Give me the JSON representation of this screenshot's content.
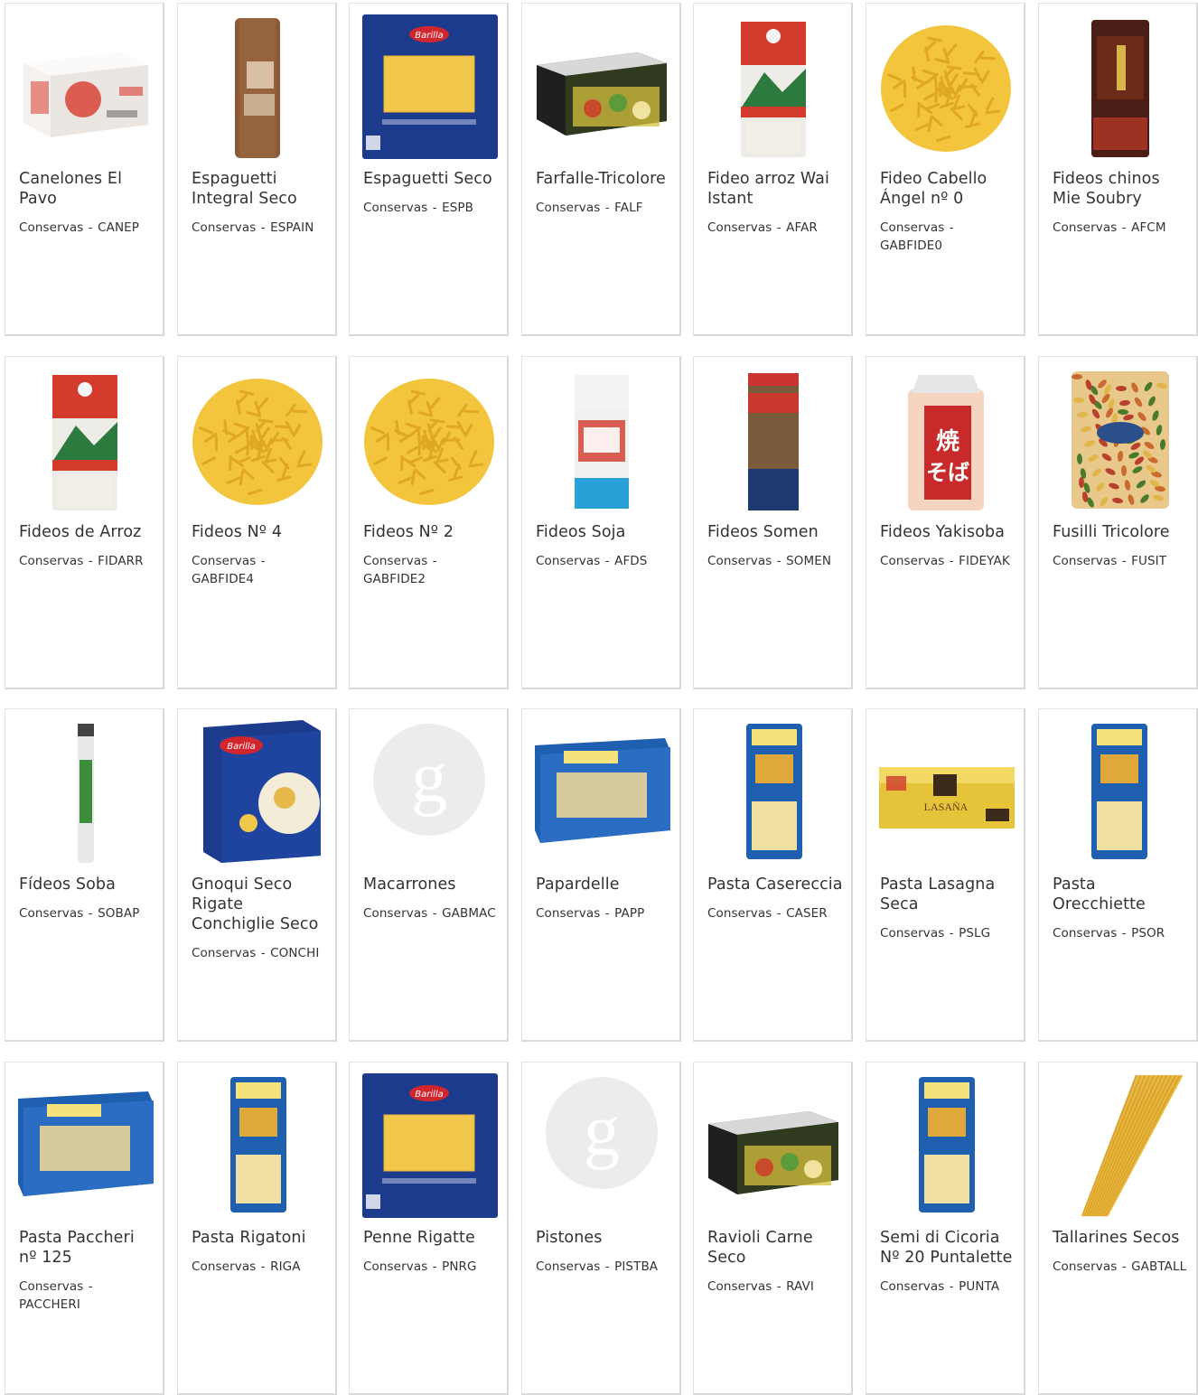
{
  "products": [
    {
      "name": "Canelones El Pavo",
      "category": "Conservas",
      "code": "CANEP",
      "image": "pasta-box-white",
      "color": "#d83a2d"
    },
    {
      "name": "Espaguetti Integral Seco",
      "category": "Conservas",
      "code": "ESPAIN",
      "image": "spaghetti-integral",
      "color": "#8a5a36"
    },
    {
      "name": "Espaguetti Seco",
      "category": "Conservas",
      "code": "ESPB",
      "image": "barilla-bag",
      "color": "#1c3b8c"
    },
    {
      "name": "Farfalle-Tricolore",
      "category": "Conservas",
      "code": "FALF",
      "image": "pasta-box-dark",
      "color": "#2b2b2b"
    },
    {
      "name": "Fideo arroz Wai Istant",
      "category": "Conservas",
      "code": "AFAR",
      "image": "rice-noodle-bag",
      "color": "#d33b2c"
    },
    {
      "name": "Fideo Cabello Ángel nº 0",
      "category": "Conservas",
      "code": "GABFIDE0",
      "image": "noodle-pile",
      "color": "#f2c53d"
    },
    {
      "name": "Fideos chinos Mie Soubry",
      "category": "Conservas",
      "code": "AFCM",
      "image": "chinese-noodle-bag",
      "color": "#4a1e14"
    },
    {
      "name": "Fideos de Arroz",
      "category": "Conservas",
      "code": "FIDARR",
      "image": "rice-noodle-bag",
      "color": "#d33b2c"
    },
    {
      "name": "Fideos Nº 4",
      "category": "Conservas",
      "code": "GABFIDE4",
      "image": "noodle-pile",
      "color": "#f2c53d"
    },
    {
      "name": "Fideos Nº 2",
      "category": "Conservas",
      "code": "GABFIDE2",
      "image": "noodle-pile",
      "color": "#f2c53d"
    },
    {
      "name": "Fideos Soja",
      "category": "Conservas",
      "code": "AFDS",
      "image": "soja-bag",
      "color": "#2aa0d8"
    },
    {
      "name": "Fideos Somen",
      "category": "Conservas",
      "code": "SOMEN",
      "image": "somen-pack",
      "color": "#7a5a3a"
    },
    {
      "name": "Fideos Yakisoba",
      "category": "Conservas",
      "code": "FIDEYAK",
      "image": "yakisoba-pack",
      "color": "#c8292a"
    },
    {
      "name": "Fusilli Tricolore",
      "category": "Conservas",
      "code": "FUSIT",
      "image": "fusilli-bag",
      "color": "#c96b2e"
    },
    {
      "name": "Fídeos Soba",
      "category": "Conservas",
      "code": "SOBAP",
      "image": "soba-pack",
      "color": "#3c8c3c"
    },
    {
      "name": "Gnoqui Seco Rigate Conchiglie Seco",
      "category": "Conservas",
      "code": "CONCHI",
      "image": "barilla-box",
      "color": "#1c3b8c"
    },
    {
      "name": "Macarrones",
      "category": "Conservas",
      "code": "GABMAC",
      "image": "placeholder",
      "color": "#eeecea"
    },
    {
      "name": "Papardelle",
      "category": "Conservas",
      "code": "PAPP",
      "image": "dececco-box",
      "color": "#1f5fb0"
    },
    {
      "name": "Pasta Casereccia",
      "category": "Conservas",
      "code": "CASER",
      "image": "dececco-bag",
      "color": "#1f5fb0"
    },
    {
      "name": "Pasta Lasagna Seca",
      "category": "Conservas",
      "code": "PSLG",
      "image": "lasagna-box",
      "color": "#e6c43a"
    },
    {
      "name": "Pasta Orecchiette",
      "category": "Conservas",
      "code": "PSOR",
      "image": "dececco-bag",
      "color": "#1f5fb0"
    },
    {
      "name": "Pasta Paccheri nº 125",
      "category": "Conservas",
      "code": "PACCHERI",
      "image": "dececco-box",
      "color": "#1f5fb0"
    },
    {
      "name": "Pasta Rigatoni",
      "category": "Conservas",
      "code": "RIGA",
      "image": "dececco-bag",
      "color": "#1f5fb0"
    },
    {
      "name": "Penne Rigatte",
      "category": "Conservas",
      "code": "PNRG",
      "image": "barilla-bag",
      "color": "#1c3b8c"
    },
    {
      "name": "Pistones",
      "category": "Conservas",
      "code": "PISTBA",
      "image": "placeholder",
      "color": "#eeecea"
    },
    {
      "name": "Ravioli Carne Seco",
      "category": "Conservas",
      "code": "RAVI",
      "image": "pasta-box-dark",
      "color": "#2b2b2b"
    },
    {
      "name": "Semi di Cicoria Nº 20 Puntalette",
      "category": "Conservas",
      "code": "PUNTA",
      "image": "dececco-bag",
      "color": "#1f5fb0"
    },
    {
      "name": "Tallarines Secos",
      "category": "Conservas",
      "code": "GABTALL",
      "image": "tallarines",
      "color": "#e8b83a"
    }
  ],
  "code_separator": "-",
  "placeholder_letter": "g",
  "colors": {
    "border": "#e3e3e3",
    "text": "#333333"
  }
}
